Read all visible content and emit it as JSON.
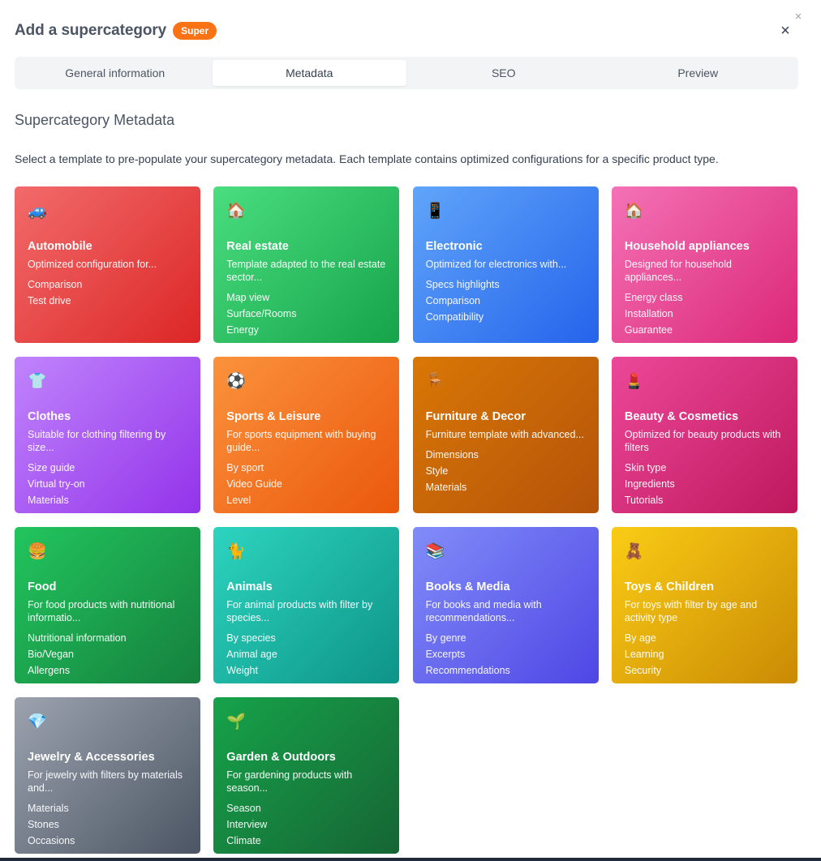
{
  "window": {
    "close_glyph": "×"
  },
  "header": {
    "title": "Add a supercategory",
    "badge": "Super",
    "close_glyph": "×"
  },
  "tabs": [
    {
      "label": "General information",
      "active": false
    },
    {
      "label": "Metadata",
      "active": true
    },
    {
      "label": "SEO",
      "active": false
    },
    {
      "label": "Preview",
      "active": false
    }
  ],
  "section": {
    "title": "Supercategory Metadata",
    "description": "Select a template to pre-populate your supercategory metadata. Each template contains optimized configurations for a specific product type."
  },
  "templates": [
    {
      "icon": "car-icon",
      "emoji": "🚙",
      "title": "Automobile",
      "desc": "Optimized configuration for...",
      "features": [
        "Comparison",
        "Test drive"
      ],
      "colors": [
        "#f26b6b",
        "#dc2626"
      ]
    },
    {
      "icon": "house-icon",
      "emoji": "🏠",
      "title": "Real estate",
      "desc": "Template adapted to the real estate sector...",
      "features": [
        "Map view",
        "Surface/Rooms",
        "Energy"
      ],
      "colors": [
        "#4ade80",
        "#16a34a"
      ]
    },
    {
      "icon": "calculator-icon",
      "emoji": "📱",
      "title": "Electronic",
      "desc": "Optimized for electronics with...",
      "features": [
        "Specs highlights",
        "Comparison",
        "Compatibility"
      ],
      "colors": [
        "#60a5fa",
        "#2563eb"
      ]
    },
    {
      "icon": "house-icon",
      "emoji": "🏠",
      "title": "Household appliances",
      "desc": "Designed for household appliances...",
      "features": [
        "Energy class",
        "Installation",
        "Guarantee"
      ],
      "colors": [
        "#f472b6",
        "#db2777"
      ]
    },
    {
      "icon": "tshirt-icon",
      "emoji": "👕",
      "title": "Clothes",
      "desc": "Suitable for clothing filtering by size...",
      "features": [
        "Size guide",
        "Virtual try-on",
        "Materials"
      ],
      "colors": [
        "#c084fc",
        "#9333ea"
      ]
    },
    {
      "icon": "soccer-ball-icon",
      "emoji": "⚽",
      "title": "Sports & Leisure",
      "desc": "For sports equipment with buying guide...",
      "features": [
        "By sport",
        "Video Guide",
        "Level"
      ],
      "colors": [
        "#fb923c",
        "#ea580c"
      ]
    },
    {
      "icon": "chair-icon",
      "emoji": "🪑",
      "title": "Furniture & Decor",
      "desc": "Furniture template with advanced...",
      "features": [
        "Dimensions",
        "Style",
        "Materials"
      ],
      "colors": [
        "#d97706",
        "#b45309"
      ]
    },
    {
      "icon": "lipstick-icon",
      "emoji": "💄",
      "title": "Beauty & Cosmetics",
      "desc": "Optimized for beauty products with filters",
      "features": [
        "Skin type",
        "Ingredients",
        "Tutorials"
      ],
      "colors": [
        "#ec4899",
        "#be185d"
      ]
    },
    {
      "icon": "burger-icon",
      "emoji": "🍔",
      "title": "Food",
      "desc": "For food products with nutritional informatio...",
      "features": [
        "Nutritional information",
        "Bio/Vegan",
        "Allergens"
      ],
      "colors": [
        "#22c55e",
        "#15803d"
      ]
    },
    {
      "icon": "cat-icon",
      "emoji": "🐈",
      "title": "Animals",
      "desc": "For animal products with filter by species...",
      "features": [
        "By species",
        "Animal age",
        "Weight"
      ],
      "colors": [
        "#2dd4bf",
        "#0d9488"
      ]
    },
    {
      "icon": "books-icon",
      "emoji": "📚",
      "title": "Books & Media",
      "desc": "For books and media with recommendations...",
      "features": [
        "By genre",
        "Excerpts",
        "Recommendations"
      ],
      "colors": [
        "#818cf8",
        "#4f46e5"
      ]
    },
    {
      "icon": "teddy-bear-icon",
      "emoji": "🧸",
      "title": "Toys & Children",
      "desc": "For toys with filter by age and activity type",
      "features": [
        "By age",
        "Learning",
        "Security"
      ],
      "colors": [
        "#facc15",
        "#ca8a04"
      ]
    },
    {
      "icon": "gem-icon",
      "emoji": "💎",
      "title": "Jewelry & Accessories",
      "desc": "For jewelry with filters by materials and...",
      "features": [
        "Materials",
        "Stones",
        "Occasions"
      ],
      "colors": [
        "#9ca3af",
        "#4b5563"
      ]
    },
    {
      "icon": "seedling-icon",
      "emoji": "🌱",
      "title": "Garden & Outdoors",
      "desc": "For gardening products with season...",
      "features": [
        "Season",
        "Interview",
        "Climate"
      ],
      "colors": [
        "#16a34a",
        "#166534"
      ]
    }
  ]
}
